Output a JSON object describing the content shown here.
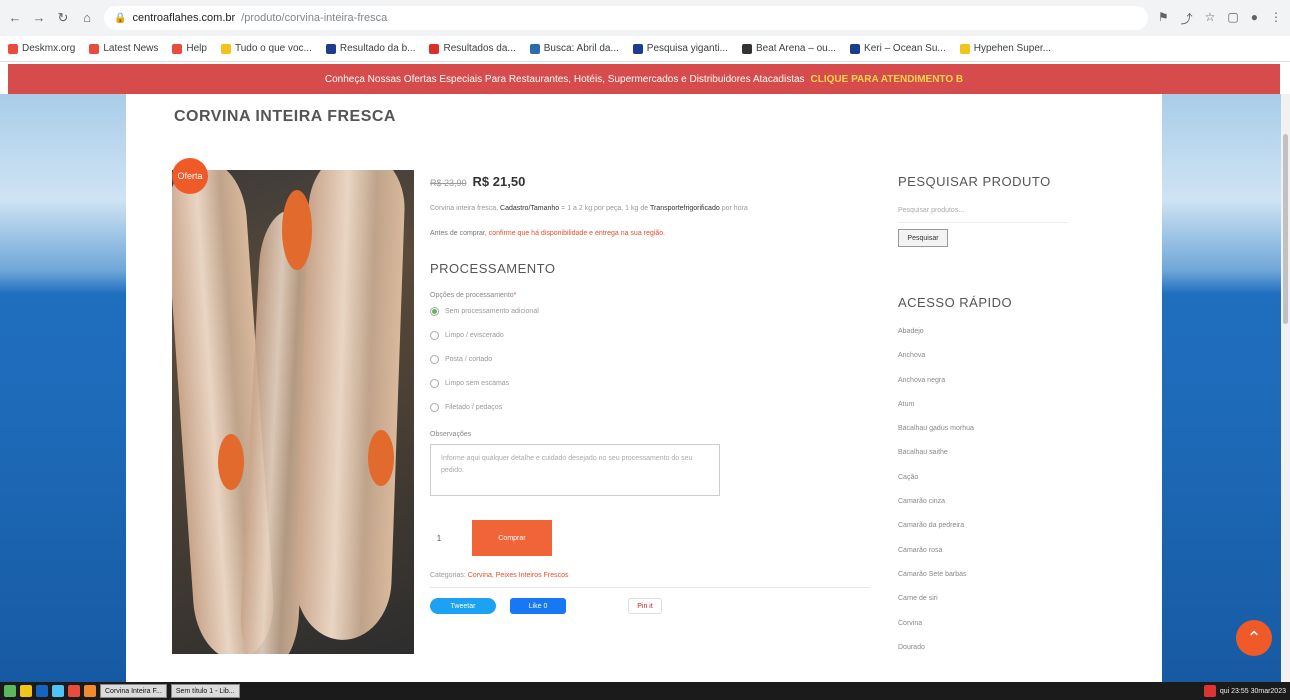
{
  "browser": {
    "url_host": "centroaflahes.com.br",
    "url_path": "/produto/corvina-inteira-fresca",
    "bookmarks": [
      "Deskmx.org",
      "Latest News",
      "Help",
      "Tudo o que voc...",
      "Resultado da b...",
      "Resultados da...",
      "Busca: Abril da...",
      "Pesquisa yiganti...",
      "Beat Arena – ou...",
      "Keri – Ocean Su...",
      "Hypehen Super..."
    ]
  },
  "promo": {
    "text": "Conheça Nossas Ofertas Especiais Para Restaurantes, Hotéis, Supermercados e Distribuidores Atacadistas",
    "cta": "CLIQUE PARA ATENDIMENTO B"
  },
  "product": {
    "title": "CORVINA INTEIRA FRESCA",
    "badge": "Oferta",
    "old_price": "R$ 23,90",
    "price": "R$ 21,50",
    "note1_a": "Corvina inteira fresca,",
    "note1_b": "Cadastro/Tamanho",
    "note1_c": "= 1 a 2 kg por peça, 1 kg de",
    "note1_d": "Transportefrigorificado",
    "note1_e": "por hora",
    "note2_a": "Antes de comprar,",
    "note2_b": "confirme que há disponibilidade e entrega na sua região.",
    "section": "PROCESSAMENTO",
    "option_label": "Opções de processamento",
    "options": [
      "Sem processamento adicional",
      "Limpo / eviscerado",
      "Posta / cortado",
      "Limpo sem escamas",
      "Filetado / pedaços"
    ],
    "obs_label": "Observações",
    "obs_placeholder": "Informe aqui qualquer detalhe e cuidado desejado no seu processamento do seu pedido.",
    "qty": "1",
    "buy": "Comprar",
    "cats_label": "Categorias:",
    "cats": "Corvina, Peixes Inteiros Frescos",
    "share_tw": "Tweetar",
    "share_fb": "Like 0",
    "share_pin": "Pin it"
  },
  "sidebar": {
    "search_title": "PESQUISAR PRODUTO",
    "search_placeholder": "Pesquisar produtos...",
    "search_btn": "Pesquisar",
    "quick_title": "ACESSO RÁPIDO",
    "quick_items": [
      "Abadejo",
      "Anchova",
      "Anchova negra",
      "Atum",
      "Bacalhau gadus morhua",
      "Bacalhau saithe",
      "Cação",
      "Camarão cinza",
      "Camarão da pedreira",
      "Camarão rosa",
      "Camarão Sete barbas",
      "Carne de siri",
      "Corvina",
      "Dourado"
    ]
  },
  "taskbar": {
    "windows": [
      "Corvina Inteira F...",
      "Sem título 1 - Lib..."
    ],
    "clock": "qui 23:55 30mar2023"
  }
}
